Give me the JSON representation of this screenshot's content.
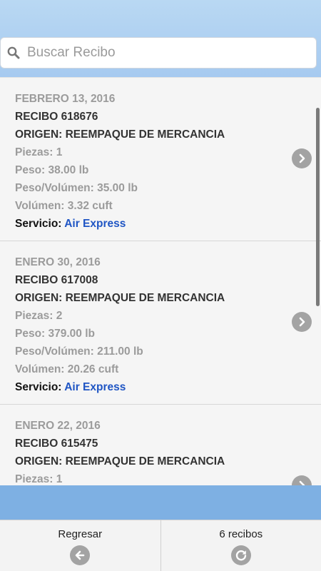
{
  "search": {
    "placeholder": "Buscar Recibo",
    "icon": "search-icon"
  },
  "receipts": [
    {
      "date": "FEBRERO 13, 2016",
      "receipt": "RECIBO 618676",
      "origin": "ORIGEN: REEMPAQUE DE MERCANCIA",
      "pieces": "Piezas: 1",
      "weight": "Peso: 38.00 lb",
      "vol_weight": "Peso/Volúmen: 35.00 lb",
      "volume": "Volúmen: 3.32 cuft",
      "service_label": "Servicio: ",
      "service_value": "Air Express"
    },
    {
      "date": "ENERO 30, 2016",
      "receipt": "RECIBO 617008",
      "origin": "ORIGEN: REEMPAQUE DE MERCANCIA",
      "pieces": "Piezas: 2",
      "weight": "Peso: 379.00 lb",
      "vol_weight": "Peso/Volúmen: 211.00 lb",
      "volume": "Volúmen: 20.26 cuft",
      "service_label": "Servicio: ",
      "service_value": "Air Express"
    },
    {
      "date": "ENERO 22, 2016",
      "receipt": "RECIBO 615475",
      "origin": "ORIGEN: REEMPAQUE DE MERCANCIA",
      "pieces": "Piezas: 1"
    }
  ],
  "footer": {
    "back_label": "Regresar",
    "count_label": "6 recibos"
  },
  "colors": {
    "header": "#b9d8f3",
    "band": "#7eb0e3",
    "service_link": "#1f55c4",
    "muted_text": "#9b9b9b"
  }
}
